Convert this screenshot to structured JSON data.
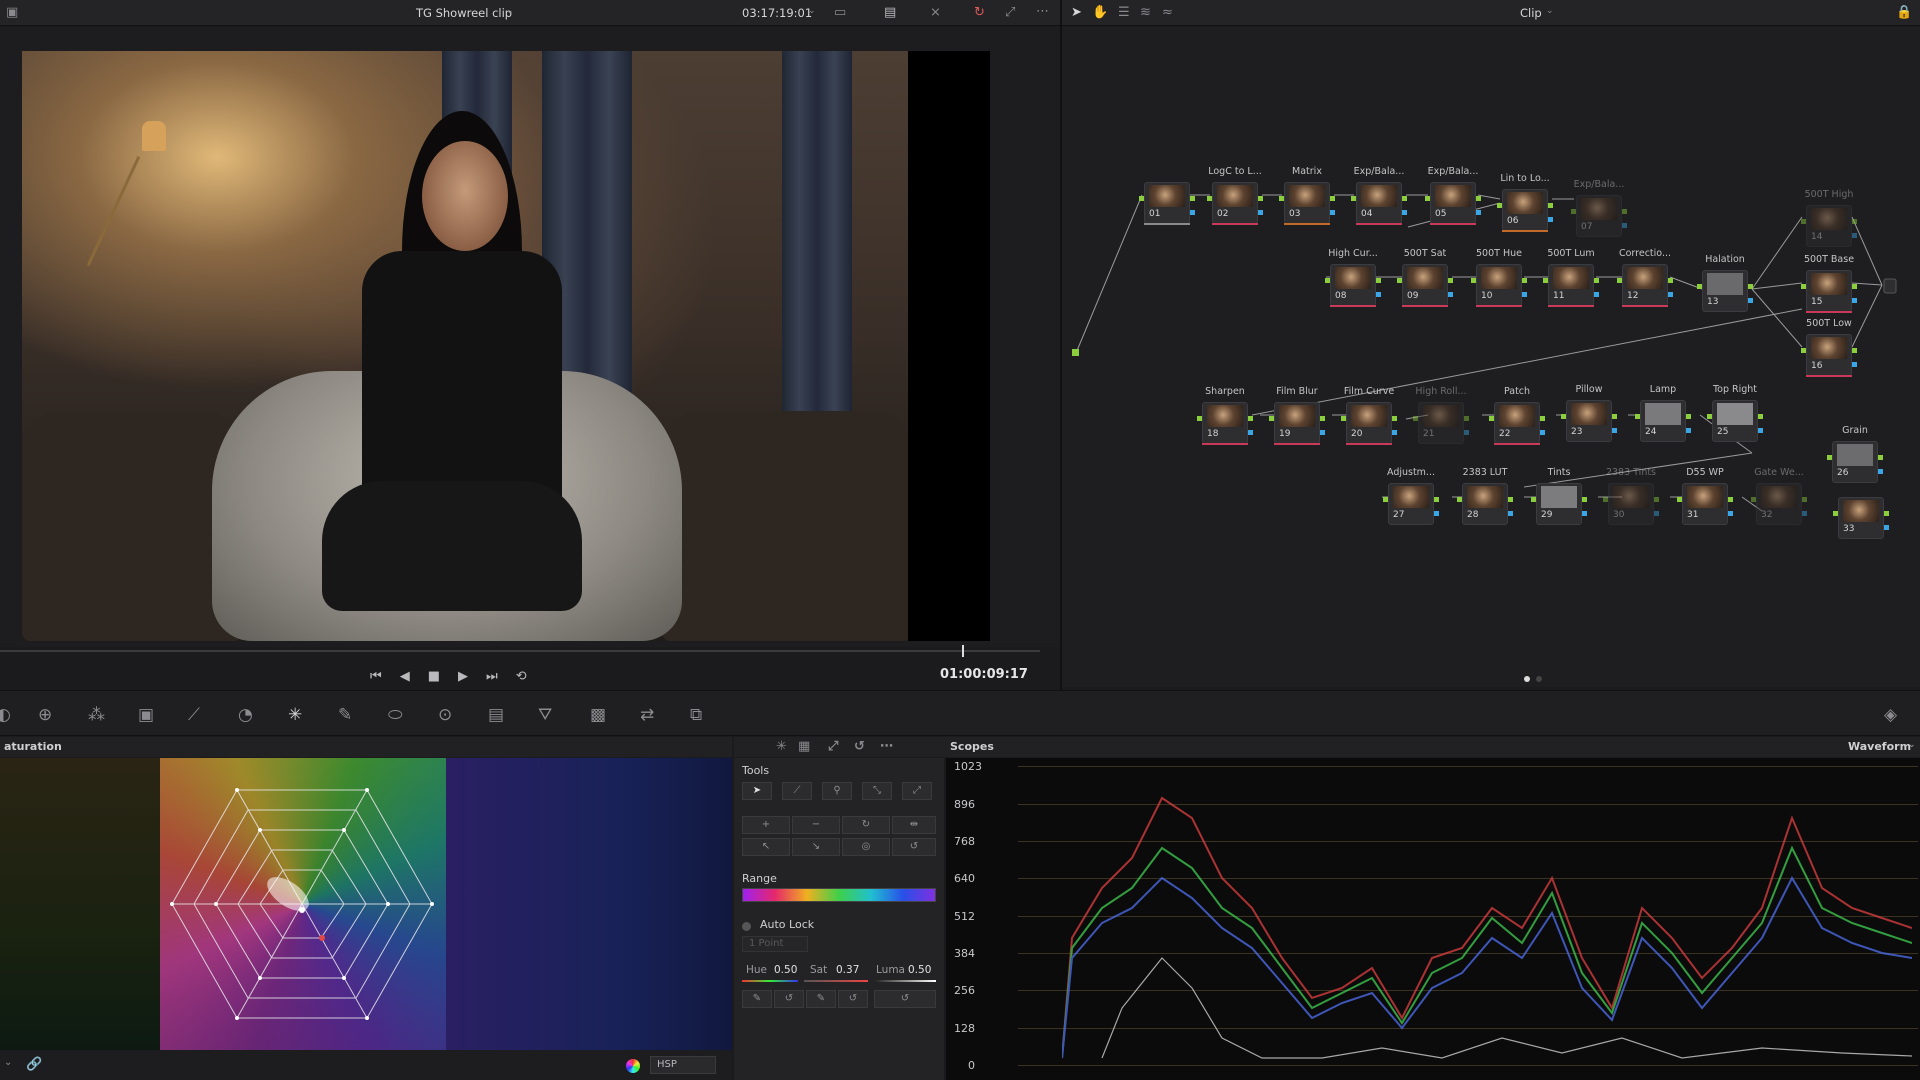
{
  "viewer": {
    "clip_title": "TG Showreel clip",
    "source_timecode": "03:17:19:01",
    "playhead_timecode": "01:00:09:17"
  },
  "node_editor": {
    "mode_label": "Clip",
    "nodes": [
      {
        "id": "01",
        "label": ""
      },
      {
        "id": "02",
        "label": "LogC to L..."
      },
      {
        "id": "03",
        "label": "Matrix"
      },
      {
        "id": "04",
        "label": "Exp/Bala..."
      },
      {
        "id": "05",
        "label": "Exp/Bala..."
      },
      {
        "id": "06",
        "label": "Lin to Lo..."
      },
      {
        "id": "07",
        "label": "Exp/Bala..."
      },
      {
        "id": "08",
        "label": "High Cur..."
      },
      {
        "id": "09",
        "label": "500T Sat"
      },
      {
        "id": "10",
        "label": "500T Hue"
      },
      {
        "id": "11",
        "label": "500T Lum"
      },
      {
        "id": "12",
        "label": "Correctio..."
      },
      {
        "id": "13",
        "label": "Halation"
      },
      {
        "id": "14",
        "label": "500T High"
      },
      {
        "id": "15",
        "label": "500T Base"
      },
      {
        "id": "16",
        "label": "500T Low"
      },
      {
        "id": "18",
        "label": "Sharpen"
      },
      {
        "id": "19",
        "label": "Film Blur"
      },
      {
        "id": "20",
        "label": "Film Curve"
      },
      {
        "id": "21",
        "label": "High Roll..."
      },
      {
        "id": "22",
        "label": "Patch"
      },
      {
        "id": "23",
        "label": "Pillow"
      },
      {
        "id": "24",
        "label": "Lamp"
      },
      {
        "id": "25",
        "label": "Top Right"
      },
      {
        "id": "26",
        "label": "Grain"
      },
      {
        "id": "27",
        "label": "Adjustm..."
      },
      {
        "id": "28",
        "label": "2383 LUT"
      },
      {
        "id": "29",
        "label": "Tints"
      },
      {
        "id": "30",
        "label": "2383 Tints"
      },
      {
        "id": "31",
        "label": "D55 WP"
      },
      {
        "id": "32",
        "label": "Gate We..."
      },
      {
        "id": "33",
        "label": ""
      }
    ]
  },
  "warper": {
    "panel_title": "aturation",
    "color_space": "HSP"
  },
  "tools": {
    "title": "Tools",
    "range_label": "Range",
    "auto_lock_label": "Auto Lock",
    "point_select": "1 Point",
    "hue_label": "Hue",
    "hue_value": "0.50",
    "sat_label": "Sat",
    "sat_value": "0.37",
    "luma_label": "Luma",
    "luma_value": "0.50"
  },
  "scopes": {
    "title": "Scopes",
    "mode": "Waveform",
    "scale": [
      "1023",
      "896",
      "768",
      "640",
      "512",
      "384",
      "256",
      "128",
      "0"
    ]
  }
}
